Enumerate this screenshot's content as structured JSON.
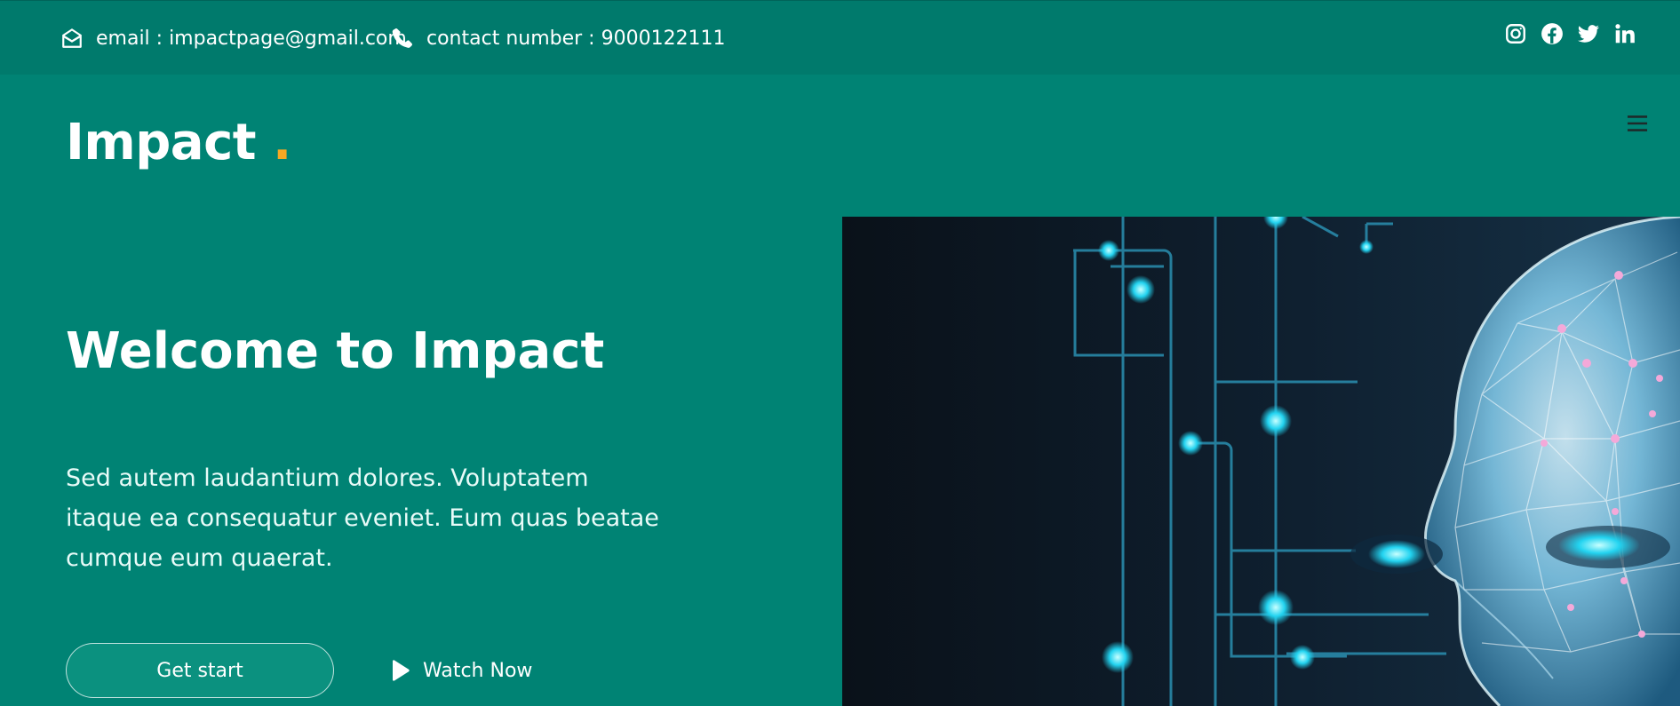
{
  "topbar": {
    "email": "email : impactpage@gmail.com",
    "phone": "contact number : 9000122111",
    "socials": [
      "instagram-icon",
      "facebook-icon",
      "twitter-icon",
      "linkedin-icon"
    ]
  },
  "brand": {
    "name": "Impact",
    "dot": ".",
    "dot_color": "#f7a823"
  },
  "header": {
    "menu_icon": "hamburger-menu-icon"
  },
  "hero": {
    "title": "Welcome to Impact",
    "text": "Sed autem laudantium dolores. Voluptatem itaque ea consequatur eveniet. Eum quas beatae cumque eum quaerat.",
    "primary_button": "Get start",
    "secondary_button": "Watch Now",
    "image_icon": "ai-face-illustration"
  },
  "colors": {
    "background": "#008374",
    "topbar": "#007a6c",
    "accent": "#f7a823"
  }
}
